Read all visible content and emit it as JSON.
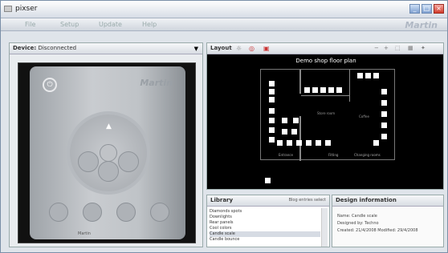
{
  "window": {
    "title": "pixser",
    "minimize": "_",
    "maximize": "□",
    "close": "×"
  },
  "menu": {
    "items": [
      "File",
      "Setup",
      "Update",
      "Help"
    ],
    "brand": "Martin"
  },
  "device_panel": {
    "label": "Device:",
    "value": "Disconnected",
    "brand": "Martin",
    "note": "Martin"
  },
  "layout_panel": {
    "label": "Layout",
    "title": "Demo shop floor plan",
    "rooms": [
      "Store room",
      "Coffee"
    ],
    "labels": [
      "Entrance",
      "Fitting",
      "Changing rooms"
    ]
  },
  "library": {
    "label": "Library",
    "link": "Blog entries select",
    "items": [
      "Diamonds spots",
      "Downlights",
      "Rear panels",
      "Cool colors",
      "Candle scale",
      "Candle bounce"
    ],
    "selected_index": 4
  },
  "info": {
    "label": "Design information",
    "rows": [
      "Name: Candle scale",
      "Designed by: Techno",
      "Created: 21/4/2008 Modified: 29/4/2008"
    ]
  }
}
